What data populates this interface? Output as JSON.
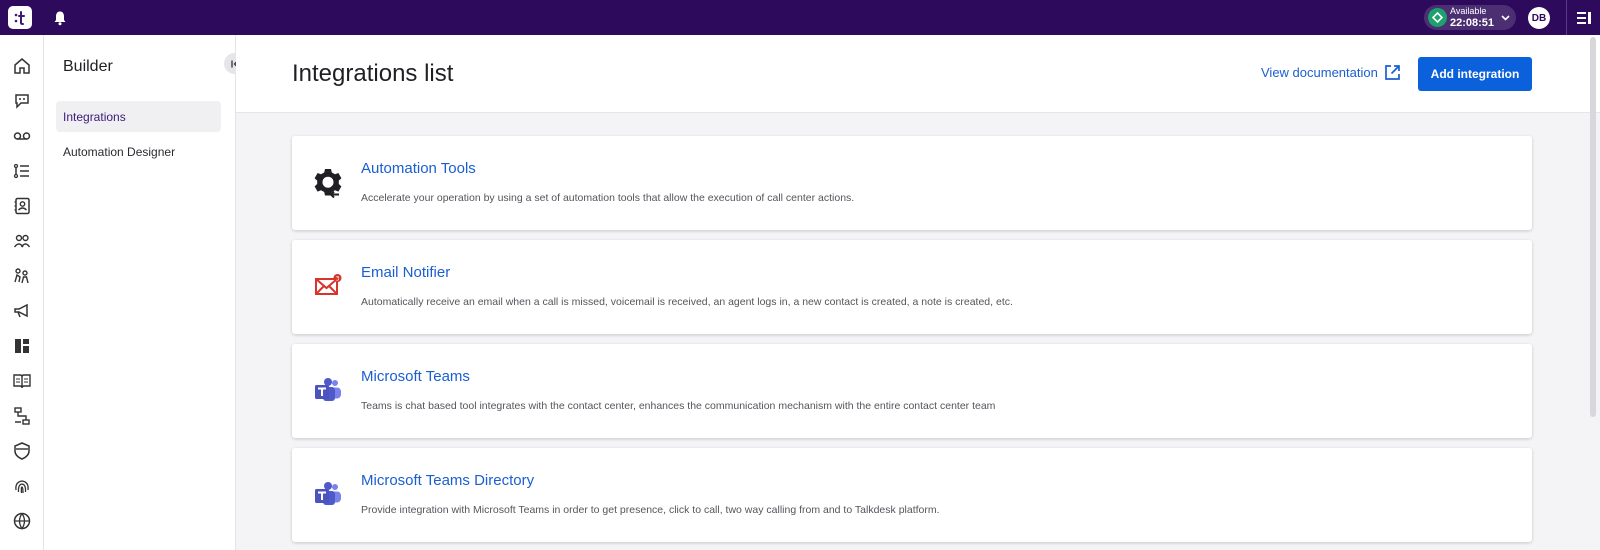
{
  "topbar": {
    "status_label": "Available",
    "status_time": "22:08:51",
    "status_color": "#1ba26f",
    "avatar_initials": "DB"
  },
  "rail": {
    "icons": [
      "home-icon",
      "chat-icon",
      "voicemail-icon",
      "list-icon",
      "contacts-icon",
      "team-icon",
      "agents-icon",
      "megaphone-icon",
      "dashboard-icon",
      "book-icon",
      "flow-icon",
      "shield-icon",
      "fingerprint-icon",
      "globe-icon"
    ]
  },
  "sidebar": {
    "title": "Builder",
    "items": [
      {
        "label": "Integrations"
      },
      {
        "label": "Automation Designer"
      }
    ]
  },
  "header": {
    "title": "Integrations list",
    "doc_link": "View documentation",
    "add_button": "Add integration",
    "accent": "#0b61dc"
  },
  "integrations": [
    {
      "title": "Automation Tools",
      "description": "Accelerate your operation by using a set of automation tools that allow the execution of call center actions.",
      "icon": "gear-sync-icon"
    },
    {
      "title": "Email Notifier",
      "description": "Automatically receive an email when a call is missed, voicemail is received, an agent logs in, a new contact is created, a note is created, etc.",
      "icon": "email-notifier-icon"
    },
    {
      "title": "Microsoft Teams",
      "description": "Teams is chat based tool integrates with the contact center, enhances the communication mechanism with the entire contact center team",
      "icon": "teams-icon"
    },
    {
      "title": "Microsoft Teams Directory",
      "description": "Provide integration with Microsoft Teams in order to get presence, click to call, two way calling from and to Talkdesk platform.",
      "icon": "teams-icon"
    }
  ]
}
